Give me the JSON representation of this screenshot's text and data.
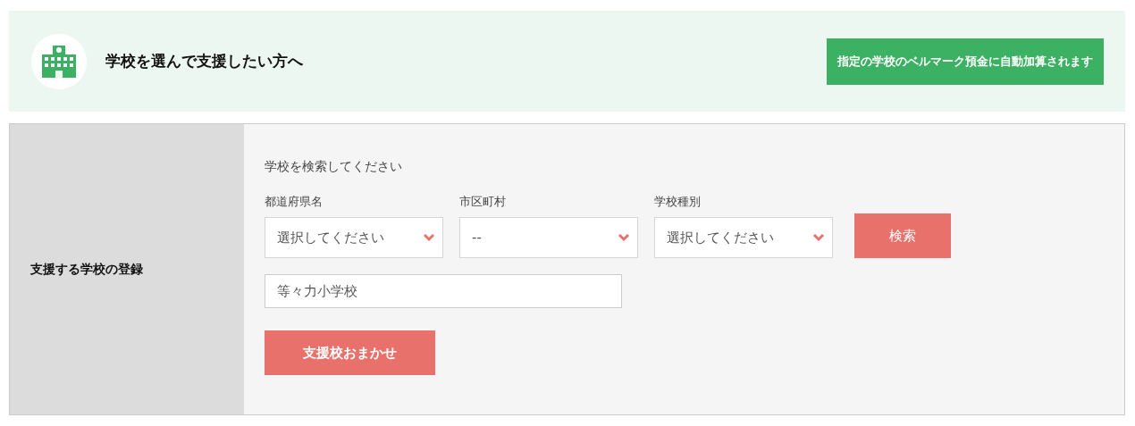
{
  "header": {
    "title": "学校を選んで支援したい方へ",
    "badge": "指定の学校のベルマーク預金に自動加算されます"
  },
  "form": {
    "label": "支援する学校の登録",
    "heading": "学校を検索してください",
    "selects": [
      {
        "label": "都道府県名",
        "value": "選択してください"
      },
      {
        "label": "市区町村",
        "value": "--"
      },
      {
        "label": "学校種別",
        "value": "選択してください"
      }
    ],
    "search_button": "検索",
    "school_name": {
      "placeholder": "等々力小学校"
    },
    "auto_button": "支援校おまかせ"
  }
}
